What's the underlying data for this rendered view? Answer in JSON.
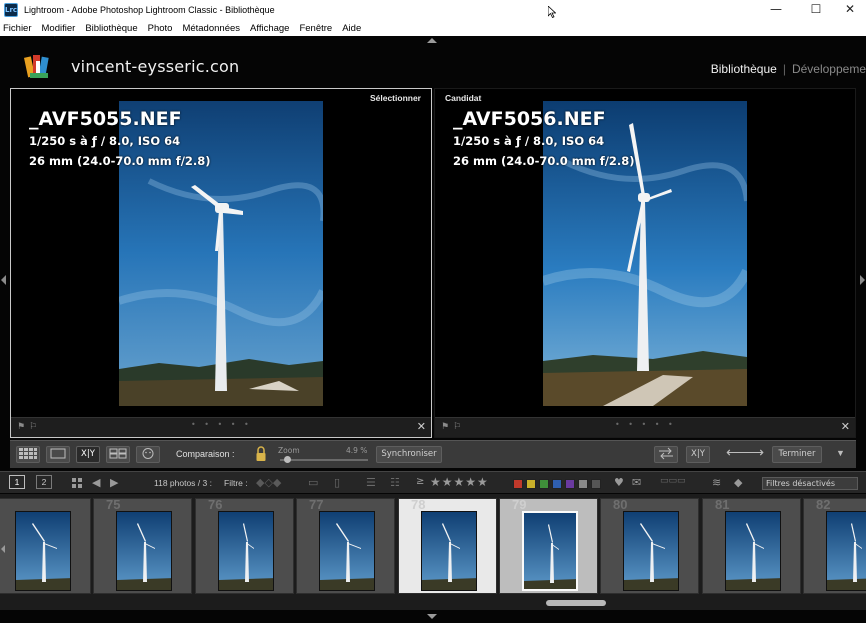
{
  "window": {
    "app_icon": "Lrc",
    "title": "Lightroom - Adobe Photoshop Lightroom Classic - Bibliothèque",
    "controls": {
      "minimize": "—",
      "maximize": "☐",
      "close": "✕"
    }
  },
  "menu": [
    "Fichier",
    "Modifier",
    "Bibliothèque",
    "Photo",
    "Métadonnées",
    "Affichage",
    "Fenêtre",
    "Aide"
  ],
  "identity": {
    "site": "vincent-eysseric.con",
    "modules": {
      "active": "Bibliothèque",
      "separator": "|",
      "next": "Développeme"
    }
  },
  "compare": {
    "select": {
      "label": "Sélectionner",
      "filename": "_AVF5055.NEF",
      "exposure": "1/250 s à ƒ / 8.0, ISO 64",
      "lens": "26 mm (24.0-70.0 mm f/2.8)"
    },
    "candidate": {
      "label": "Candidat",
      "filename": "_AVF5056.NEF",
      "exposure": "1/250 s à ƒ / 8.0, ISO 64",
      "lens": "26 mm (24.0-70.0 mm f/2.8)"
    },
    "pane_dots": "• • • • •",
    "close": "✕"
  },
  "toolbar": {
    "comparison_label": "Comparaison :",
    "zoom_label": "Zoom",
    "zoom_value": "4.9 %",
    "zoom_fraction": 0.05,
    "sync_button": "Synchroniser",
    "xy_label": "X|Y",
    "done_button": "Terminer"
  },
  "filmstrip_header": {
    "view1": "1",
    "view2": "2",
    "count": "118 photos / 3 :",
    "filter_label": "Filtre :",
    "stars": "★★★★★",
    "filter_select": "Filtres désactivés"
  },
  "colors": {
    "label_red": "#c0392b",
    "label_yellow": "#c9b02a",
    "label_green": "#3f8f3a",
    "label_blue": "#2f5fb0",
    "label_purple": "#6a3aa0",
    "label_gray": "#8a8a8a",
    "label_dark": "#555555"
  },
  "filmstrip": {
    "cells": [
      {
        "num": "",
        "state": "normal"
      },
      {
        "num": "75",
        "state": "normal"
      },
      {
        "num": "76",
        "state": "normal"
      },
      {
        "num": "77",
        "state": "normal"
      },
      {
        "num": "78",
        "state": "selected"
      },
      {
        "num": "79",
        "state": "candidate"
      },
      {
        "num": "80",
        "state": "normal"
      },
      {
        "num": "81",
        "state": "normal"
      },
      {
        "num": "82",
        "state": "normal"
      }
    ]
  }
}
